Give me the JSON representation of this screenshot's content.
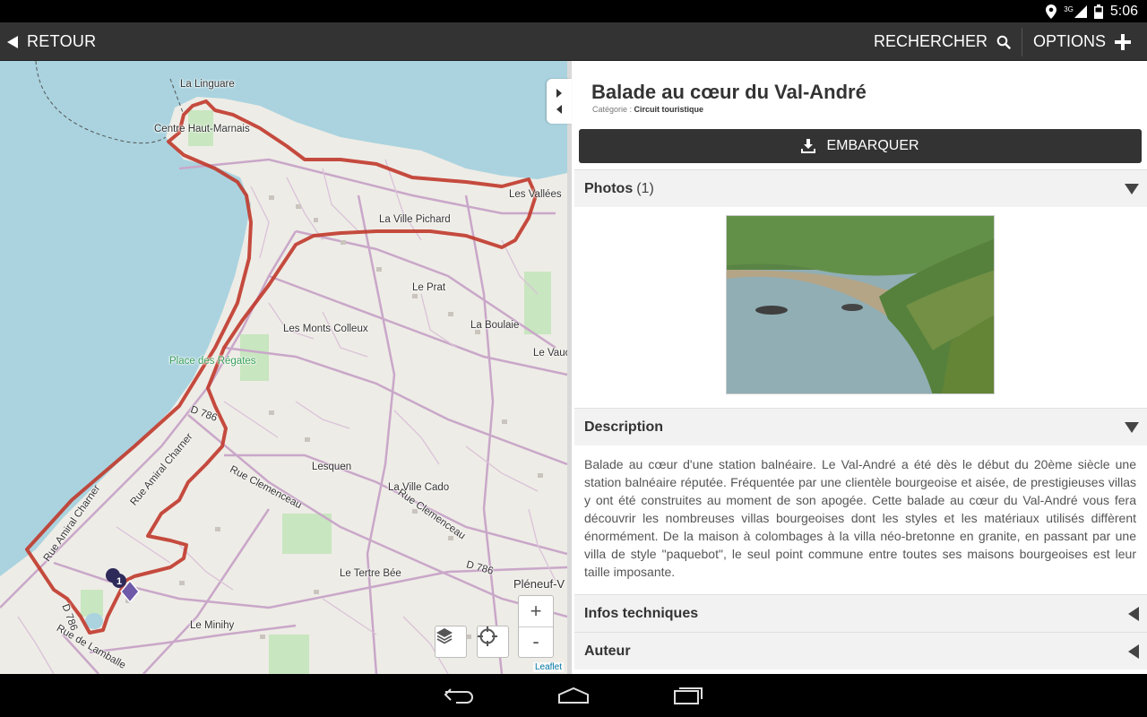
{
  "statusbar": {
    "time": "5:06",
    "network": "3G"
  },
  "actionbar": {
    "back_label": "RETOUR",
    "search_label": "RECHERCHER",
    "options_label": "OPTIONS"
  },
  "map": {
    "labels": {
      "la_linguare": "La Linguare",
      "centre_haut_marnais": "Centre Haut-Marnais",
      "les_vallees": "Les Vallées",
      "la_ville_pichard": "La Ville Pichard",
      "le_prat": "Le Prat",
      "la_boulaie": "La Boulaie",
      "les_monts_colleux": "Les Monts Colleux",
      "le_vauc": "Le Vauc",
      "place_des_regates": "Place des Régates",
      "d786_a": "D 786",
      "rue_amiral_charner_a": "Rue Amiral Charner",
      "rue_amiral_charner_b": "Rue Amiral Charner",
      "rue_clemenceau_a": "Rue Clemenceau",
      "rue_clemenceau_b": "Rue Clemenceau",
      "lesquen": "Lesquen",
      "la_ville_cado": "La Ville Cado",
      "d786_b": "D 786",
      "le_tertre_bee": "Le Tertre Bée",
      "pleneuf": "Pléneuf-V",
      "le_minihy": "Le Minihy",
      "rue_de_lamballe": "Rue de Lamballe",
      "d786_c": "D 786"
    },
    "marker_number": "1",
    "zoom_in": "+",
    "zoom_out": "-",
    "attribution": "Leaflet"
  },
  "panel": {
    "title": "Balade au cœur du Val-André",
    "category_label": "Catégorie : ",
    "category_value": "Circuit touristique",
    "embark_label": "EMBARQUER",
    "photos_label": "Photos",
    "photos_count": "(1)",
    "description_label": "Description",
    "description_text": "Balade au cœur d'une station balnéaire. Le Val-André a été dès le début du 20ème siècle une station balnéaire réputée. Fréquentée par une clientèle bourgeoise et aisée, de prestigieuses villas y ont été construites au moment de son apogée. Cette balade au cœur du Val-André vous fera découvrir les nombreuses villas bourgeoises dont les styles et les matériaux utilisés diffèrent énormément. De la maison à colombages à la villa néo-bretonne en granite, en passant par une villa de style \"paquebot\", le seul point commune entre toutes ses maisons bourgeoises est leur taille imposante.",
    "infos_label": "Infos techniques",
    "author_label": "Auteur"
  },
  "colors": {
    "track": "#c0392b",
    "sea": "#aad3df",
    "bar": "#333333"
  }
}
